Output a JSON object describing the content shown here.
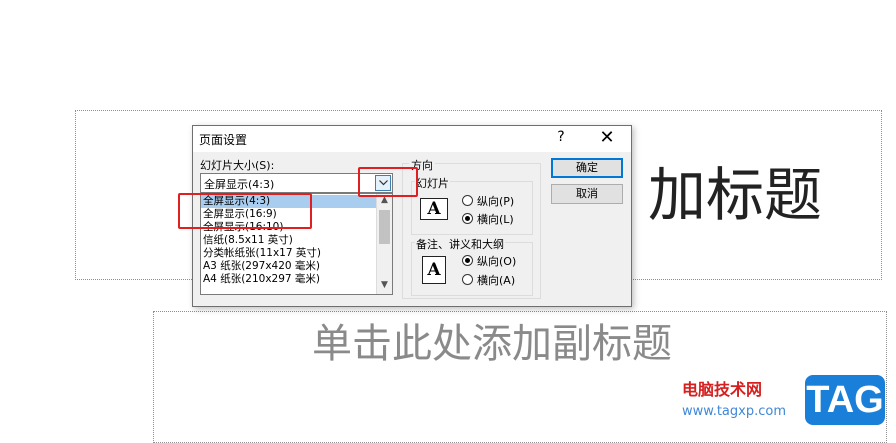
{
  "slide": {
    "title_text": "加标题",
    "subtitle_text": "单击此处添加副标题"
  },
  "dialog": {
    "title": "页面设置",
    "help_label": "?",
    "close_label": "✕",
    "slide_size_label": "幻灯片大小(S):",
    "slide_size_value": "全屏显示(4:3)",
    "size_options": [
      "全屏显示(4:3)",
      "全屏显示(16:9)",
      "全屏显示(16:10)",
      "信纸(8.5x11 英寸)",
      "分类帐纸张(11x17 英寸)",
      "A3 纸张(297x420 毫米)",
      "A4 纸张(210x297 毫米)"
    ],
    "selected_option_index": 0,
    "orientation_label": "方向",
    "slides_group_label": "幻灯片",
    "slides_portrait": "纵向(P)",
    "slides_landscape": "横向(L)",
    "slides_selected": "landscape",
    "notes_group_label": "备注、讲义和大纲",
    "notes_portrait": "纵向(O)",
    "notes_landscape": "横向(A)",
    "notes_selected": "portrait",
    "ok_label": "确定",
    "cancel_label": "取消",
    "page_icon_letter": "A"
  },
  "watermark": {
    "site_name": "电脑技术网",
    "url": "www.tagxp.com",
    "badge": "TAG"
  },
  "colors": {
    "highlight_box": "#e02020",
    "selection": "#a8cdef",
    "accent": "#0078d7"
  }
}
